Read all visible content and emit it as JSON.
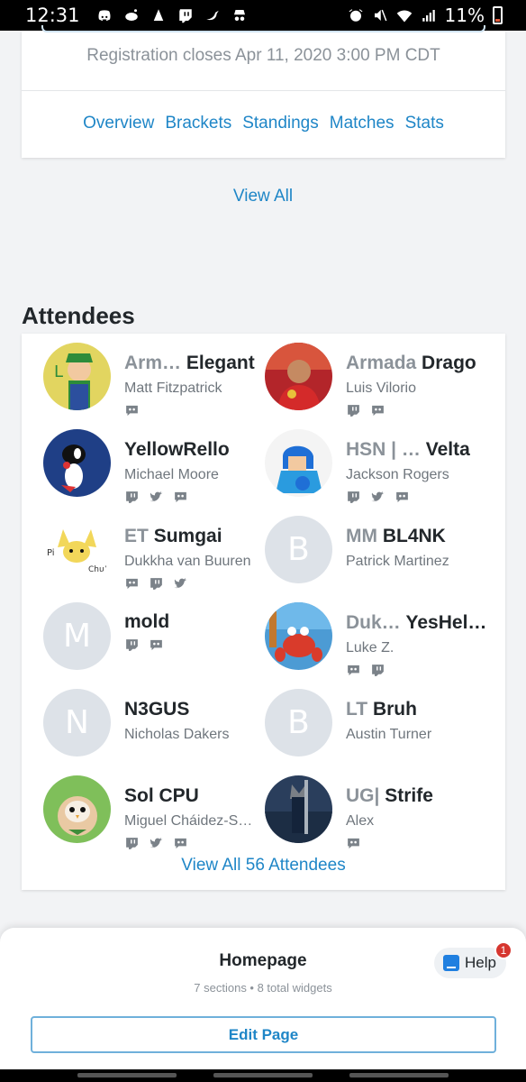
{
  "status_bar": {
    "time": "12:31",
    "battery": "11%",
    "icons": [
      "discord-icon",
      "reddit-icon",
      "amazon-icon",
      "twitch-icon",
      "bird-icon",
      "incognito-icon",
      "alarm-icon",
      "mute-icon",
      "wifi-icon",
      "signal-icon"
    ]
  },
  "event_card": {
    "registration": "Registration closes Apr 11, 2020 3:00 PM CDT",
    "tabs": [
      "Overview",
      "Brackets",
      "Standings",
      "Matches",
      "Stats"
    ]
  },
  "view_all": "View All",
  "attendees": {
    "title": "Attendees",
    "list": [
      {
        "prefix": "Arm…",
        "gamer": "Elegant",
        "real": "Matt Fitzpatrick",
        "avatar": "luigi",
        "socials": [
          "discord"
        ]
      },
      {
        "prefix": "Armada",
        "gamer": "Drago",
        "real": "Luis Vilorio",
        "avatar": "photo",
        "socials": [
          "twitch",
          "discord"
        ]
      },
      {
        "prefix": "",
        "gamer": "YellowRello",
        "real": "Michael Moore",
        "avatar": "yoshi",
        "socials": [
          "twitch",
          "twitter",
          "discord"
        ]
      },
      {
        "prefix": "HSN | …",
        "gamer": "Velta",
        "real": "Jackson Rogers",
        "avatar": "megaman",
        "socials": [
          "twitch",
          "twitter",
          "discord"
        ]
      },
      {
        "prefix": "ET",
        "gamer": "Sumgai",
        "real": "Dukkha van Buuren",
        "avatar": "pichu",
        "socials": [
          "discord",
          "twitch",
          "twitter"
        ]
      },
      {
        "prefix": "MM",
        "gamer": "BL4NK",
        "real": "Patrick Martinez",
        "avatar": "B",
        "socials": []
      },
      {
        "prefix": "",
        "gamer": "mold",
        "real": "",
        "avatar": "M",
        "socials": [
          "twitch",
          "discord"
        ]
      },
      {
        "prefix": "Duk…",
        "gamer": "YesHel…",
        "real": "Luke Z.",
        "avatar": "crab",
        "socials": [
          "discord",
          "twitch"
        ]
      },
      {
        "prefix": "",
        "gamer": "N3GUS",
        "real": "Nicholas Dakers",
        "avatar": "N",
        "socials": []
      },
      {
        "prefix": "LT",
        "gamer": "Bruh",
        "real": "Austin Turner",
        "avatar": "B",
        "socials": []
      },
      {
        "prefix": "",
        "gamer": "Sol CPU",
        "real": "Miguel Cháidez-S…",
        "avatar": "rowlet",
        "socials": [
          "twitch",
          "twitter",
          "discord"
        ]
      },
      {
        "prefix": "UG|",
        "gamer": "Strife",
        "real": "Alex",
        "avatar": "cloud",
        "socials": [
          "discord"
        ]
      }
    ],
    "view_all_label": "View All 56 Attendees"
  },
  "sheet": {
    "title": "Homepage",
    "subtitle": "7 sections • 8 total widgets",
    "edit_label": "Edit Page",
    "help_label": "Help",
    "help_badge": "1"
  },
  "colors": {
    "link": "#1f86c7",
    "muted": "#8b9299",
    "avatar_placeholder": "#dde2e8"
  }
}
